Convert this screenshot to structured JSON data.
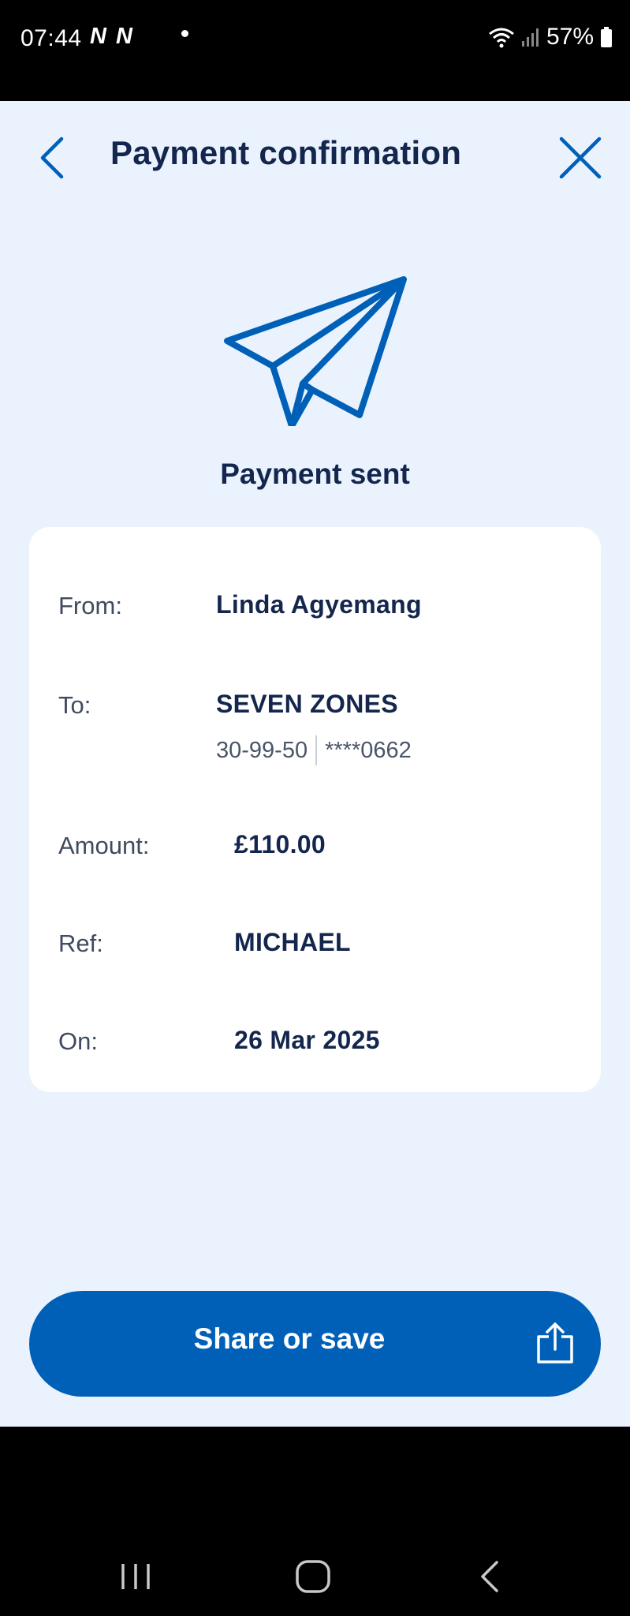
{
  "status_bar": {
    "time": "07:44",
    "notifications": "N N ",
    "battery": "57%"
  },
  "header": {
    "title": "Payment confirmation",
    "back_icon": "chevron-left-icon",
    "close_icon": "close-icon"
  },
  "hero": {
    "icon": "paper-plane-icon",
    "heading": "Payment sent"
  },
  "details": {
    "from": {
      "label": "From:",
      "value": "Linda Agyemang"
    },
    "to": {
      "label": "To:",
      "value": "SEVEN ZONES",
      "sort_code": "30-99-50",
      "account": "****0662"
    },
    "amount": {
      "label": "Amount:",
      "value": "£110.00"
    },
    "ref": {
      "label": "Ref:",
      "value": "MICHAEL"
    },
    "on": {
      "label": "On:",
      "value": "26 Mar 2025"
    }
  },
  "actions": {
    "share_label": "Share or save",
    "share_icon": "share-icon"
  },
  "colors": {
    "accent": "#0060b8",
    "title_text": "#14264d",
    "background": "#eaf3fd",
    "card": "#ffffff"
  }
}
